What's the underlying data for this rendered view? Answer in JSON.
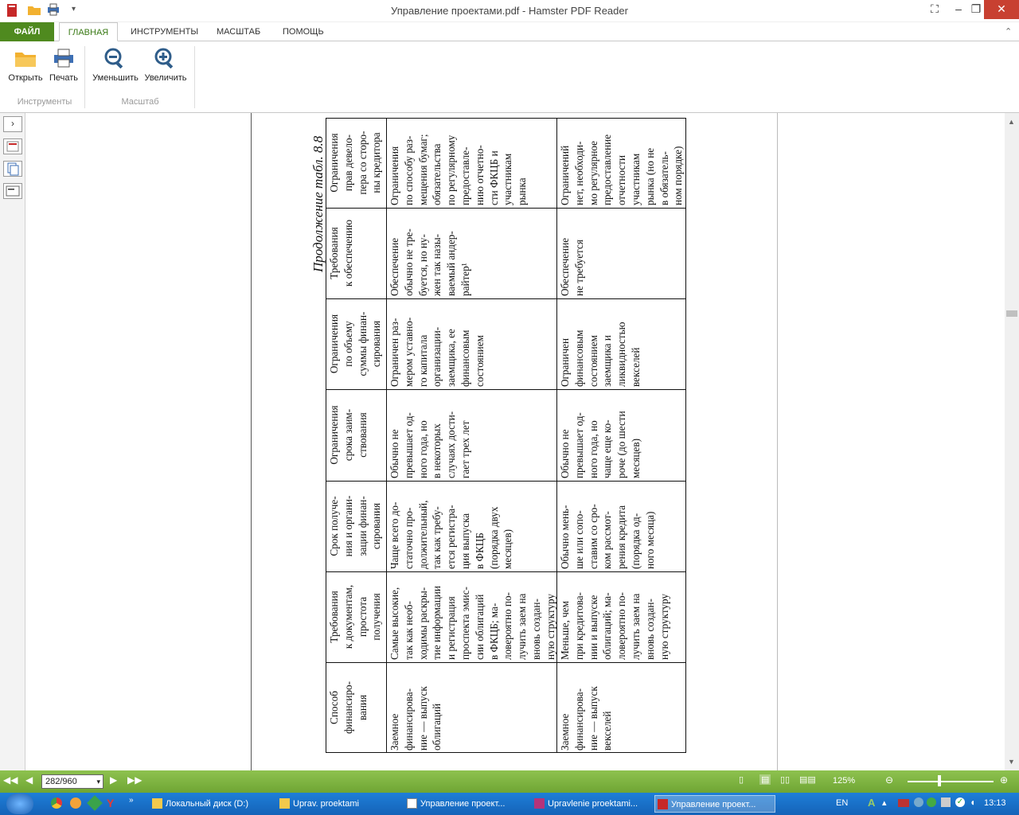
{
  "window": {
    "title": "Управление проектами.pdf - Hamster PDF Reader",
    "minimize": "–",
    "maximize": "❐",
    "close": "✕",
    "restore_left": "⛶"
  },
  "colors": {
    "accent": "#4f8a1f",
    "status": "#7cb342",
    "close": "#c84031"
  },
  "tabs": [
    {
      "label": "ФАЙЛ"
    },
    {
      "label": "ГЛАВНАЯ"
    },
    {
      "label": "ИНСТРУМЕНТЫ"
    },
    {
      "label": "МАСШТАБ"
    },
    {
      "label": "ПОМОЩЬ"
    }
  ],
  "ribbon": {
    "open": "Открыть",
    "print": "Печать",
    "zoom_out": "Уменьшить",
    "zoom_in": "Увеличить",
    "group_tools": "Инструменты",
    "group_scale": "Масштаб"
  },
  "document": {
    "caption": "Продолжение табл. 8.8",
    "headers": [
      "Способ\nфинансиро-\nвания",
      "Требования\nк документам,\nпростота\nполучения",
      "Срок получе-\nния и органи-\nзации финан-\nсирования",
      "Ограничения\nсрока заим-\nствования",
      "Ограничения\nпо объему\nсуммы финан-\nсирования",
      "Требования\nк обеспечению",
      "Ограничения\nправ девело-\nпера со сторо-\nны кредитора"
    ],
    "rows": [
      [
        "Заемное\nфинансирова-\nние — выпуск\nоблигаций",
        "Самые высокие,\nтак как необ-\nходимы раскры-\nтие информации\nи регистрация\nпроспекта эмис-\nсии облигаций\nв ФКЦБ; ма-\nловероятно по-\nлучить заем на\nвновь создан-\nную структуру",
        "Чаще всего до-\nстаточно про-\nдолжительный,\nтак как требу-\nется регистра-\nция выпуска\nв ФКЦБ\n(порядка двух\nмесяцев)",
        "Обычно не\nпревышает од-\nного года, но\nв некоторых\nслучаях дости-\nгает трех лет",
        "Ограничен раз-\nмером уставно-\nго капитала\nорганизации-\nзаемщика, ее\nфинансовым\nсостоянием",
        "Обеспечение\nобычно не тре-\nбуется, но ну-\nжен так назы-\nваемый андер-\nрайтер¹",
        "Ограничения\nпо способу раз-\nмещения бумаг;\nобязательства\nпо регулярному\nпредоставле-\nнию отчетно-\nсти ФКЦБ и\nучастникам\nрынка"
      ],
      [
        "Заемное\nфинансирова-\nние — выпуск\nвекселей",
        "Меньше, чем\nпри кредитова-\nнии и выпуске\nоблигаций; ма-\nловероятно по-\nлучить заем на\nвновь создан-\nную структуру",
        "Обычно мень-\nше или сопо-\nставим со сро-\nком рассмот-\nрения кредита\n(порядка од-\nного месяца)",
        "Обычно не\nпревышает од-\nного года, но\nчаще еще ко-\nроче (до шести\nмесяцев)",
        "Ограничен\nфинансовым\nсостоянием\nзаемщика и\nликвидностью\nвекселей",
        "Обеспечение\nне требуется",
        "Ограничений\nнет, необходи-\nмо регулярное\nпредоставление\nотчетности\nучастникам\nрынка (но не\nв обязатель-\nном порядке)"
      ]
    ]
  },
  "status": {
    "page_value": "282/960",
    "zoom": "125%",
    "zoom_fraction": 0.37
  },
  "taskbar": {
    "items": [
      {
        "label": "Локальный диск (D:)"
      },
      {
        "label": "Uprav. proektami"
      },
      {
        "label": "Управление проект..."
      },
      {
        "label": "Upravlenie proektami..."
      },
      {
        "label": "Управление проект..."
      }
    ],
    "lang": "EN",
    "time": "13:13"
  }
}
